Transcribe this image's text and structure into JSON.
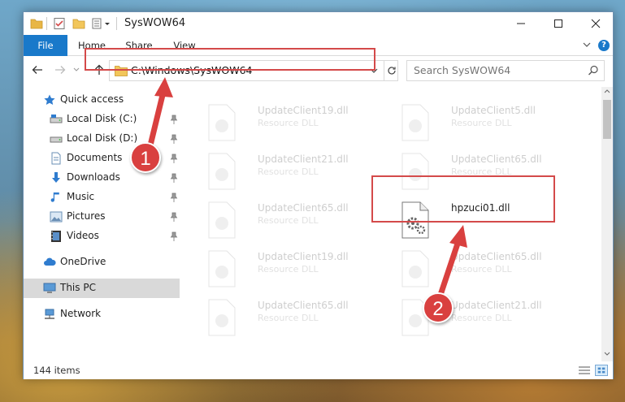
{
  "window": {
    "title": "SysWOW64",
    "minimize_icon": "minimize-icon",
    "maximize_icon": "maximize-icon",
    "close_icon": "close-icon"
  },
  "ribbon": {
    "tabs": [
      {
        "label": "File"
      },
      {
        "label": "Home"
      },
      {
        "label": "Share"
      },
      {
        "label": "View"
      }
    ]
  },
  "nav": {
    "address": "C:\\Windows\\SysWOW64",
    "search_placeholder": "Search SysWOW64"
  },
  "sidebar": {
    "items": [
      {
        "label": "Quick access",
        "icon": "star-icon"
      },
      {
        "label": "Local Disk (C:)",
        "icon": "drive-icon"
      },
      {
        "label": "Local Disk (D:)",
        "icon": "drive-icon"
      },
      {
        "label": "Documents",
        "icon": "documents-icon"
      },
      {
        "label": "Downloads",
        "icon": "downloads-icon"
      },
      {
        "label": "Music",
        "icon": "music-icon"
      },
      {
        "label": "Pictures",
        "icon": "pictures-icon"
      },
      {
        "label": "Videos",
        "icon": "videos-icon"
      },
      {
        "label": "OneDrive",
        "icon": "cloud-icon"
      },
      {
        "label": "This PC",
        "icon": "computer-icon"
      },
      {
        "label": "Network",
        "icon": "network-icon"
      }
    ]
  },
  "files": [
    {
      "name": "UpdateClient19.dll",
      "type": "Resource DLL"
    },
    {
      "name": "UpdateClient5.dll",
      "type": "Resource DLL"
    },
    {
      "name": "UpdateClient21.dll",
      "type": "Resource DLL"
    },
    {
      "name": "UpdateClient65.dll",
      "type": "Resource DLL"
    },
    {
      "name": "UpdateClient65.dll",
      "type": "Resource DLL"
    },
    {
      "name": "hpzuci01.dll",
      "type": ""
    },
    {
      "name": "UpdateClient19.dll",
      "type": "Resource DLL"
    },
    {
      "name": "UpdateClient65.dll",
      "type": "Resource DLL"
    },
    {
      "name": "UpdateClient65.dll",
      "type": "Resource DLL"
    },
    {
      "name": "UpdateClient21.dll",
      "type": "Resource DLL"
    }
  ],
  "status": {
    "item_count": "144 items"
  },
  "callouts": {
    "one": "1",
    "two": "2"
  },
  "colors": {
    "accent": "#1979ca",
    "highlight_red": "#d44a4a",
    "callout_red": "#d9403f"
  }
}
